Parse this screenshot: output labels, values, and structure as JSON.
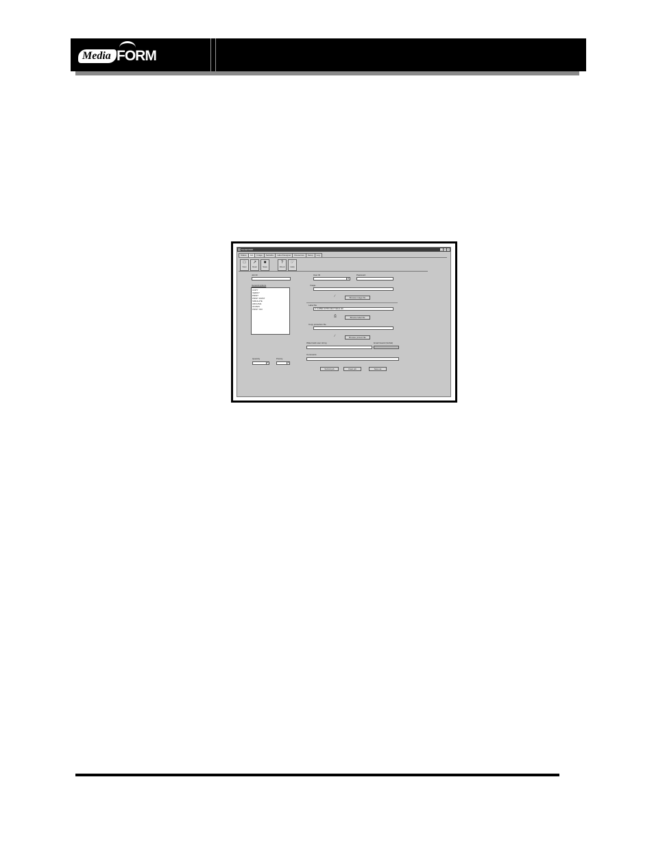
{
  "header": {
    "logo_media": "Media",
    "logo_form": "FORM"
  },
  "app": {
    "title": "MediaFORM",
    "window_controls": [
      "_",
      "□",
      "×"
    ],
    "tabs": [
      "Status",
      "Job",
      "Image",
      "Serialize",
      "Label Designer",
      "Resources",
      "Setup",
      "Log"
    ],
    "toolbar": [
      {
        "label": "New",
        "icon": "new-document-icon"
      },
      {
        "label": "Open",
        "icon": "open-folder-icon"
      },
      {
        "label": "Save",
        "icon": "save-disk-icon"
      },
      {
        "label": "About",
        "icon": "help-question-icon"
      },
      {
        "label": "Help",
        "icon": "help-pointer-icon"
      }
    ]
  },
  "form": {
    "job_id_label": "Job ID",
    "general_options_label": "General options",
    "general_options": [
      "COPY",
      "VERIFY",
      "PRINT",
      "PRINT FIRST",
      "SIMULATE",
      "ARCHIVE",
      "ON-BAY",
      "PRINT ISO"
    ],
    "quantity_label": "Quantity",
    "quantity_value": "",
    "priority_label": "Priority",
    "priority_value": "",
    "user_id_label": "User ID",
    "password_label": "Password",
    "image_label": "Image",
    "browse_image_label": "Browse image file",
    "label_file_label": "Label file",
    "label_file_value": "C:\\LABELS\\PROJECT\\label.lab",
    "browse_label_label": "Browse label file",
    "copy_protection_label": "Copy protection file",
    "browse_protect_label": "Browse protect file",
    "watermark_label": "Watermark user string",
    "email_label": "Email Guard (Verbal)",
    "comments_label": "Comments",
    "submit_label": "Submit job",
    "clear_label": "Clear job",
    "save_as_label": "Save as"
  }
}
